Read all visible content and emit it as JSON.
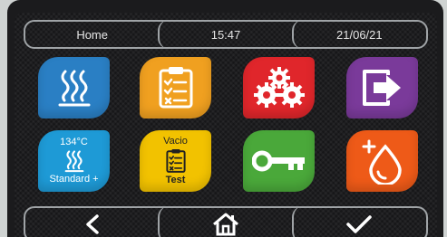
{
  "header": {
    "screen_label": "Home",
    "time": "15:47",
    "date": "21/06/21"
  },
  "tiles": [
    {
      "icon": "sterilizer-heat-icon",
      "color": "#2a7fc4"
    },
    {
      "icon": "clipboard-checklist-icon",
      "color": "#f0a020"
    },
    {
      "icon": "gears-settings-icon",
      "color": "#e0262b"
    },
    {
      "icon": "exit-arrow-icon",
      "color": "#7a3a9a"
    },
    {
      "icon": "sterilizer-heat-icon",
      "color": "#1e9ad6",
      "top_label": "134°C",
      "bottom_label": "Standard +"
    },
    {
      "icon": "clipboard-checklist-icon",
      "color": "#f2c200",
      "top_label": "Vacio",
      "bottom_label": "Test"
    },
    {
      "icon": "key-icon",
      "color": "#4aa83a"
    },
    {
      "icon": "water-drop-add-icon",
      "color": "#ee5a18"
    }
  ],
  "footer": {
    "icons": [
      "back-chevron-icon",
      "home-icon",
      "confirm-check-icon"
    ]
  }
}
